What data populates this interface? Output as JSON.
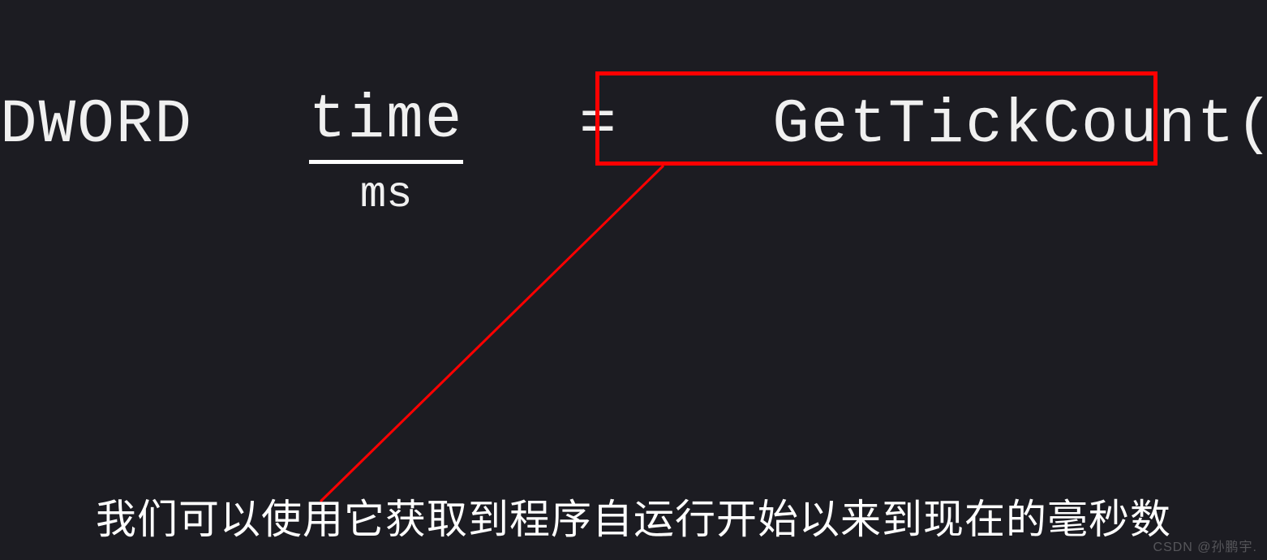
{
  "code": {
    "type_kw": "DWORD",
    "var_name": "time",
    "var_underline_label": "ms",
    "equals": "=",
    "func_call": "GetTickCount()"
  },
  "highlight": {
    "color": "#ff0000"
  },
  "arrow": {
    "color": "#ff0000"
  },
  "caption": "我们可以使用它获取到程序自运行开始以来到现在的毫秒数",
  "watermark": "CSDN @孙鹏宇."
}
